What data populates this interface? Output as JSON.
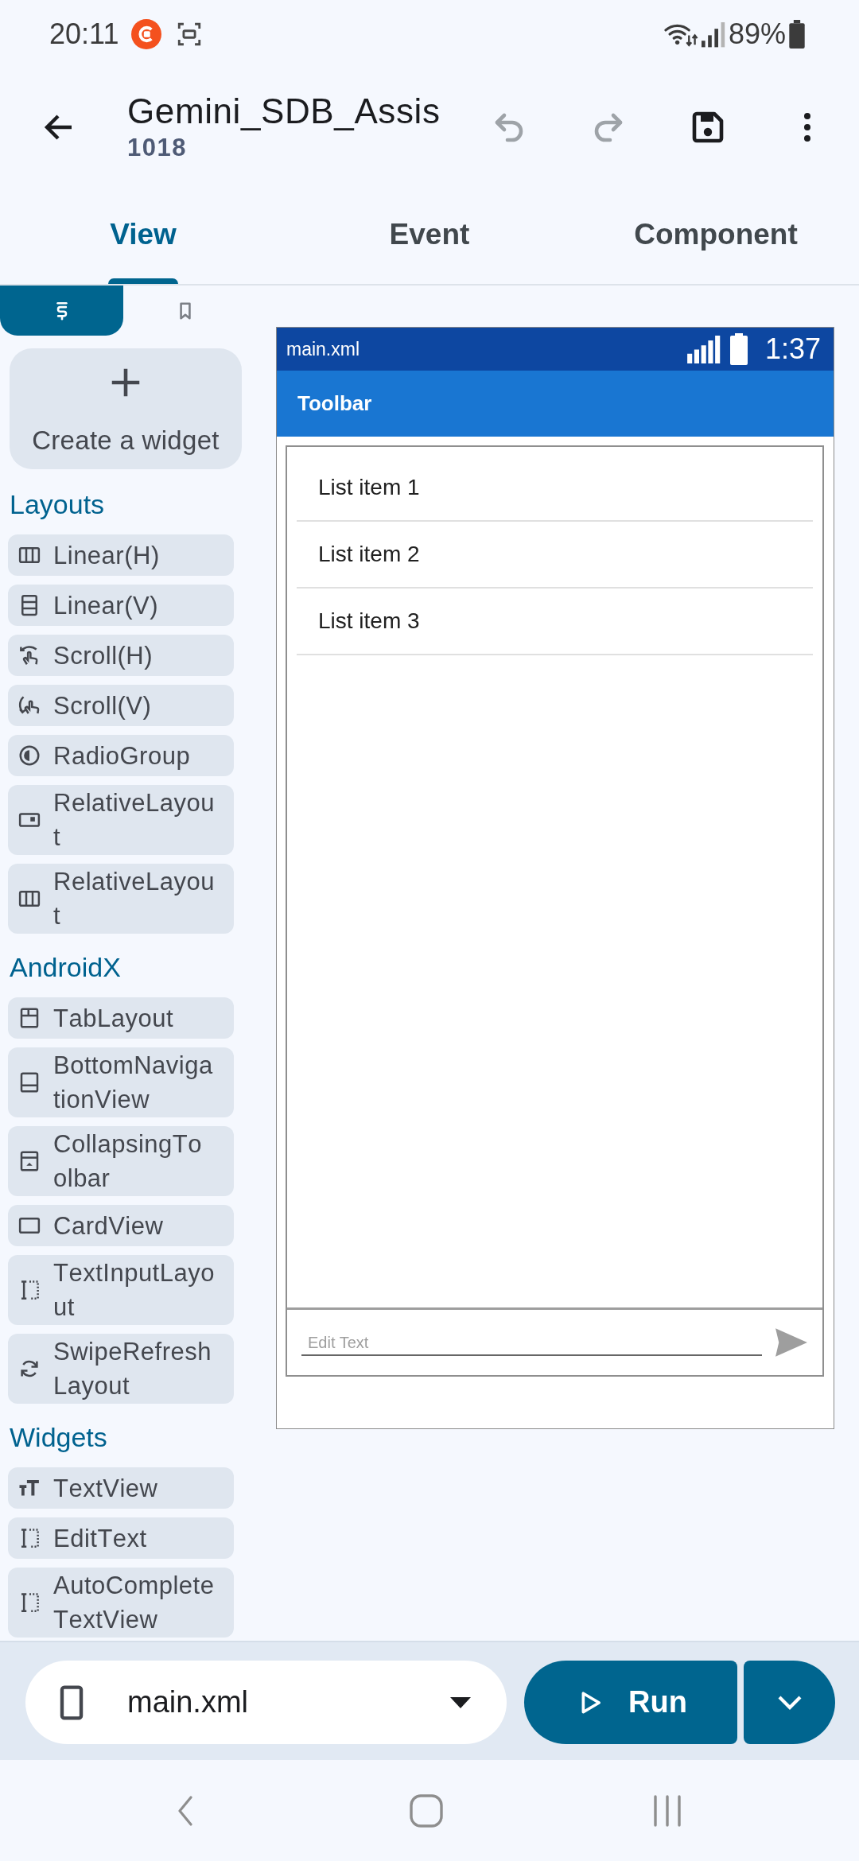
{
  "status_bar": {
    "time": "20:11",
    "battery": "89%"
  },
  "app_bar": {
    "title": "Gemini_SDB_Assis",
    "subtitle": "1018",
    "actions": [
      {
        "kind": "undo",
        "disabled": true
      },
      {
        "kind": "redo",
        "disabled": true
      },
      {
        "kind": "save",
        "disabled": false
      },
      {
        "kind": "more",
        "disabled": false
      }
    ]
  },
  "tabs": [
    {
      "label": "View",
      "selected": true
    },
    {
      "label": "Event",
      "selected": false
    },
    {
      "label": "Component",
      "selected": false
    }
  ],
  "palette": {
    "tabs": [
      {
        "kind": "widgets",
        "selected": true
      },
      {
        "kind": "bookmarks",
        "selected": false
      }
    ],
    "create_button": {
      "label": "Create a widget"
    },
    "sections": [
      {
        "title": "Layouts",
        "items": [
          {
            "kind": "columns",
            "label": "Linear(H)"
          },
          {
            "kind": "rows",
            "label": "Linear(V)"
          },
          {
            "kind": "hscroll",
            "label": "Scroll(H)"
          },
          {
            "kind": "vscroll",
            "label": "Scroll(V)"
          },
          {
            "kind": "radio",
            "label": "RadioGroup"
          },
          {
            "kind": "relative",
            "label": "RelativeLayout"
          },
          {
            "kind": "columns",
            "label": "RelativeLayout"
          }
        ]
      },
      {
        "title": "AndroidX",
        "items": [
          {
            "kind": "tabs",
            "label": "TabLayout"
          },
          {
            "kind": "bottomnav",
            "label": "BottomNavigationView"
          },
          {
            "kind": "collapsing",
            "label": "CollapsingToolbar"
          },
          {
            "kind": "card",
            "label": "CardView"
          },
          {
            "kind": "edittext",
            "label": "TextInputLayout"
          },
          {
            "kind": "refresh",
            "label": "SwipeRefreshLayout"
          }
        ]
      },
      {
        "title": "Widgets",
        "items": [
          {
            "kind": "text",
            "label": "TextView"
          },
          {
            "kind": "edittext",
            "label": "EditText"
          },
          {
            "kind": "edittext",
            "label": "AutoCompleteTextView"
          }
        ]
      }
    ]
  },
  "preview": {
    "file_name": "main.xml",
    "clock": "1:37",
    "toolbar_title": "Toolbar",
    "list_items": [
      "List item 1",
      "List item 2",
      "List item 3"
    ],
    "edit_text": {
      "placeholder": "Edit Text"
    }
  },
  "bottom_bar": {
    "file_selector": {
      "value": "main.xml"
    },
    "run_button": {
      "label": "Run"
    }
  }
}
